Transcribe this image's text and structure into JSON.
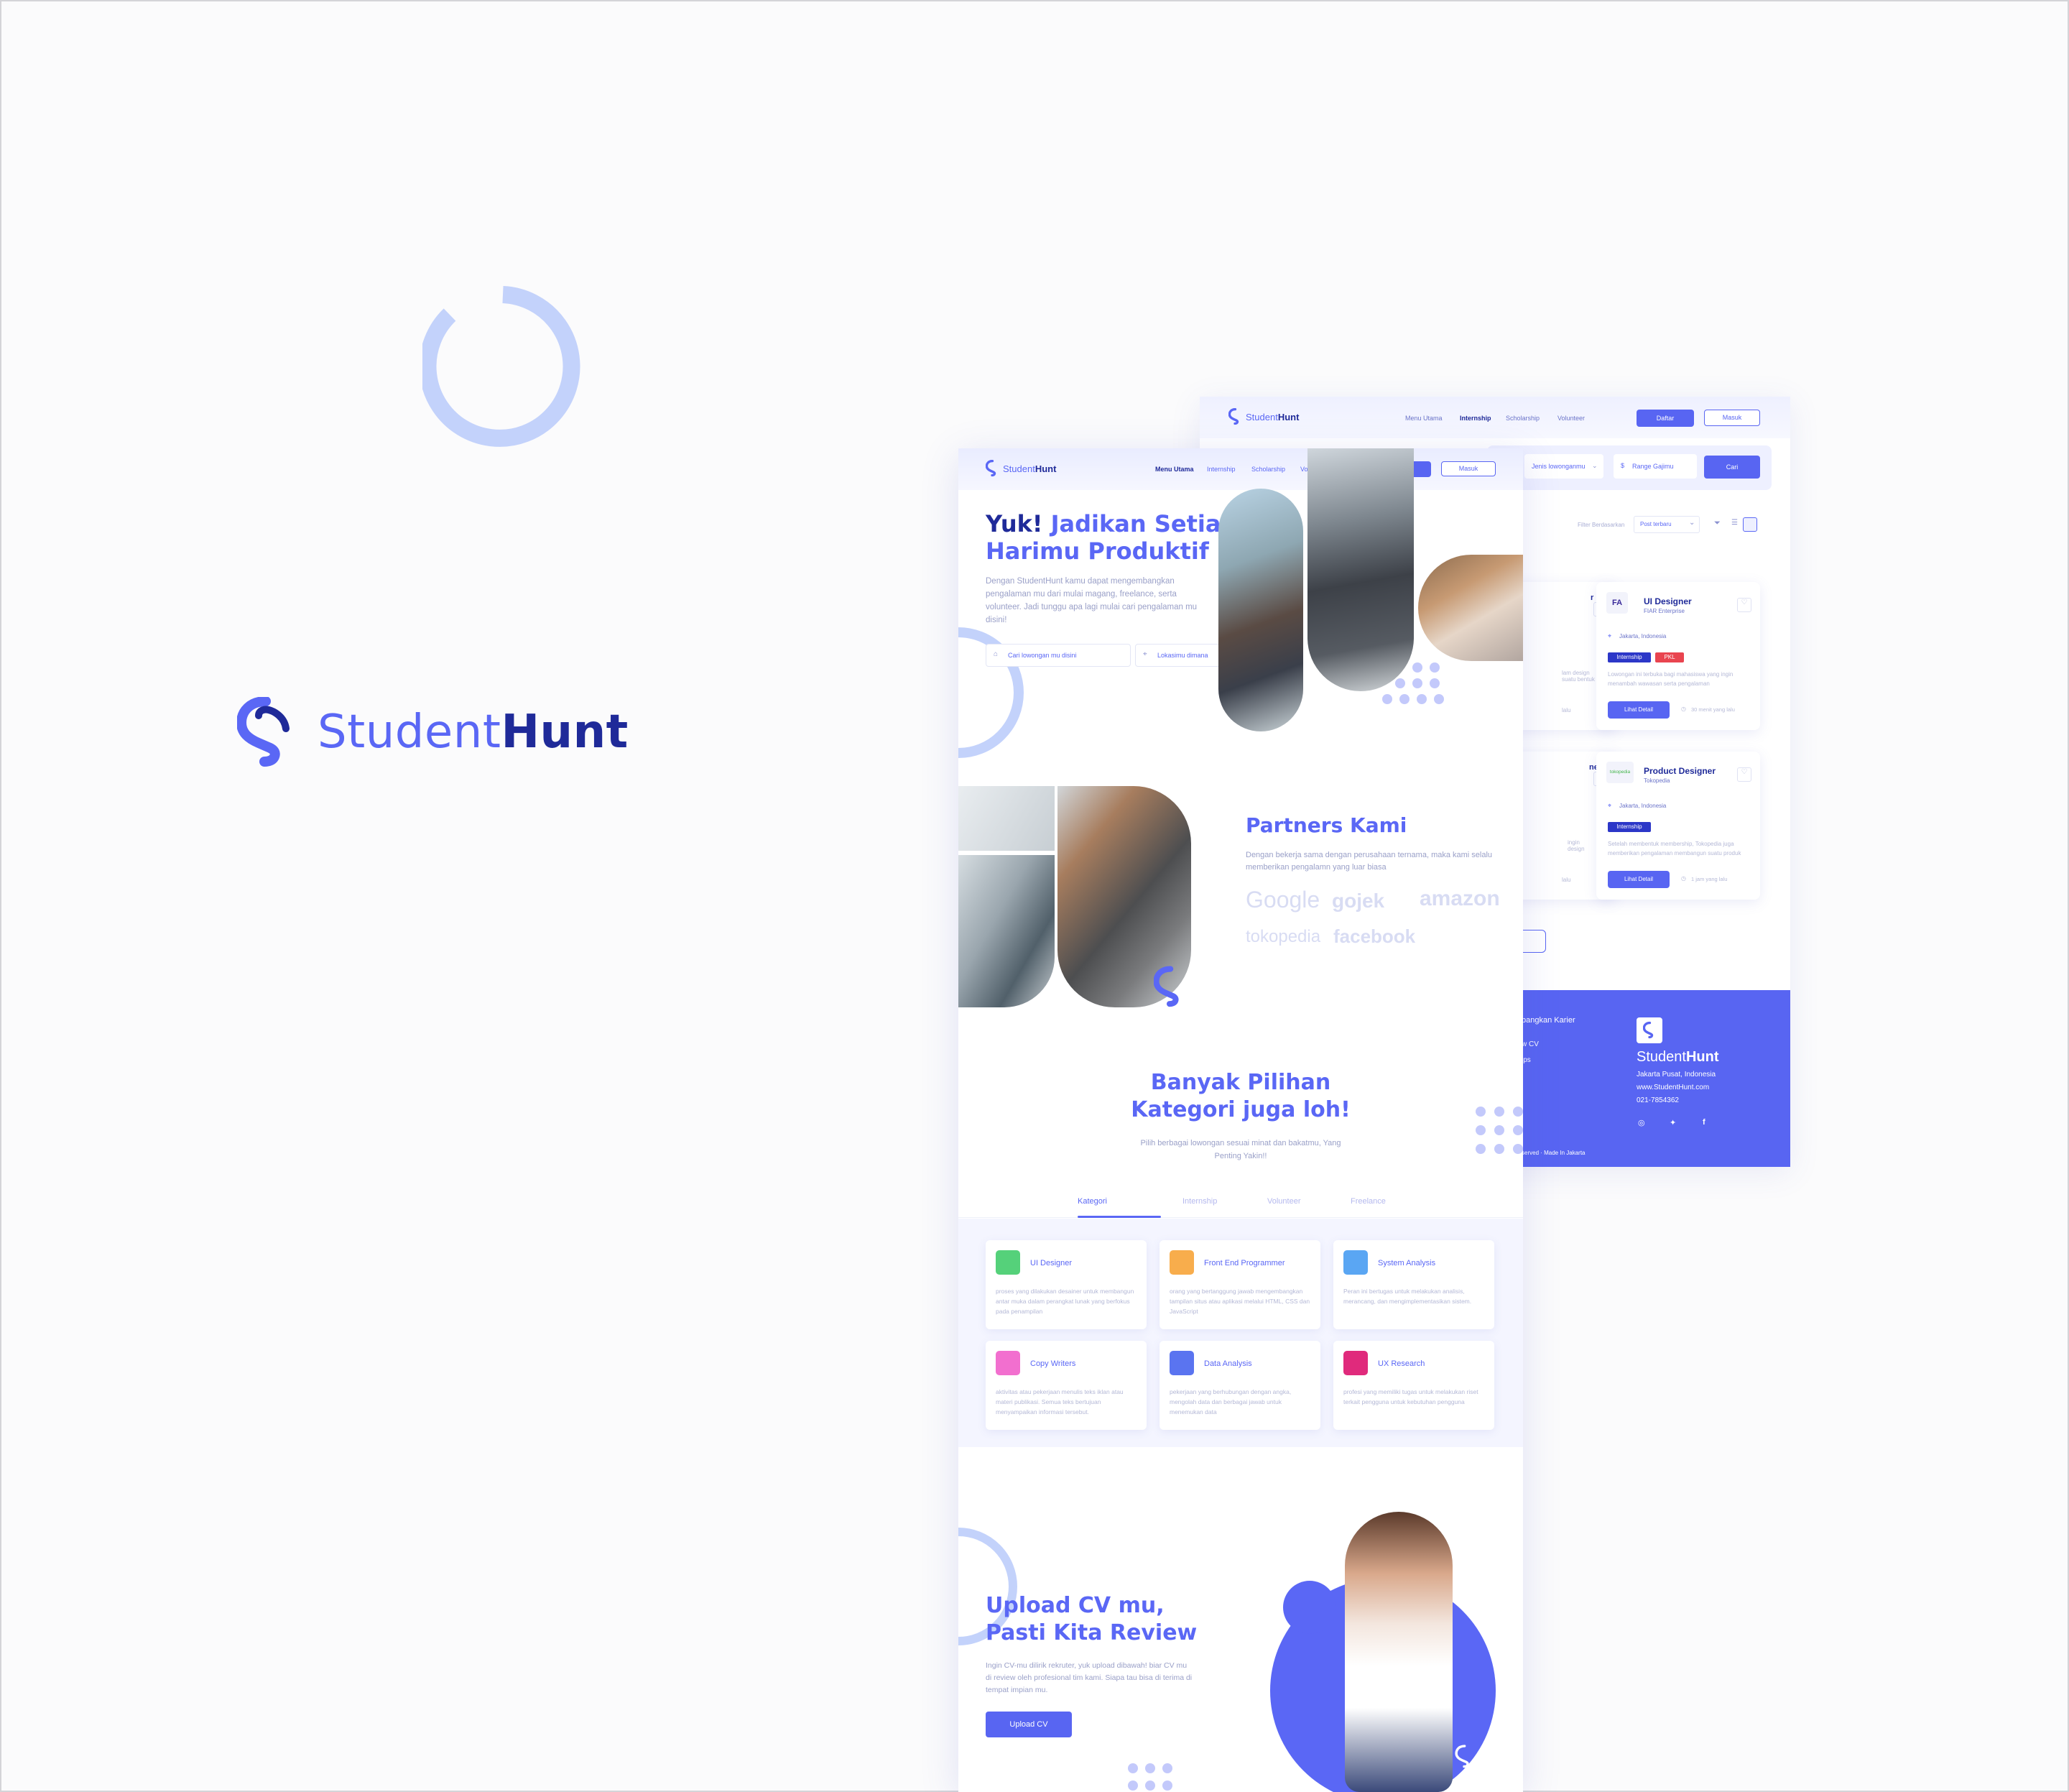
{
  "brand": {
    "part1": "Student",
    "part2": "Hunt"
  },
  "back": {
    "logo": {
      "part1": "Student",
      "part2": "Hunt"
    },
    "nav": [
      "Menu Utama",
      "Internship",
      "Scholarship",
      "Volunteer"
    ],
    "btn_daftar": "Daftar",
    "btn_masuk": "Masuk",
    "filter_jenis": "Jenis lowonganmu",
    "filter_gaji": "Range Gajimu",
    "btn_cari": "Cari",
    "sort_label": "Filter Berdasarkan",
    "sort_value": "Post terbaru",
    "cards": [
      {
        "title": "UI Designer",
        "company": "FIAR Enterprise",
        "location": "Jakarta, Indonesia",
        "tags": [
          "Internship",
          "PKL"
        ],
        "desc": "Lowongan ini terbuka bagi mahasiswa yang ingin menambah wawasan serta pengalaman",
        "button": "Lihat Detail",
        "time": "30 menit yang lalu",
        "logo": "FA"
      },
      {
        "title": "Product Designer",
        "company": "Tokopedia",
        "location": "Jakarta, Indonesia",
        "tags": [
          "Internship"
        ],
        "desc": "Setelah membentuk membership, Tokopedia juga memberikan pengalaman membangun suatu produk",
        "button": "Lihat Detail",
        "time": "1 jam yang lalu",
        "logo": "tokopedia"
      }
    ],
    "partial_cards": [
      {
        "title_frag": "r",
        "desc": "lam design\nsuatu bentuk",
        "time": "lalu"
      },
      {
        "title_frag": "ner",
        "desc": "ingin\ndesign",
        "time": "lalu"
      }
    ],
    "footer": {
      "col_title": "bangkan Karier",
      "col_items": [
        "w CV",
        "ips"
      ],
      "brand": {
        "part1": "Student",
        "part2": "Hunt"
      },
      "address": "Jakarta Pusat, Indonesia",
      "web": "www.StudentHunt.com",
      "phone": "021-7854362",
      "social": [
        "instagram-icon",
        "twitter-icon",
        "facebook-icon"
      ],
      "copy": "served · Made In Jakarta"
    }
  },
  "front": {
    "logo": {
      "part1": "Student",
      "part2": "Hunt"
    },
    "nav": [
      "Menu Utama",
      "Internship",
      "Scholarship",
      "Volunteer"
    ],
    "btn_daftar": "Daftar",
    "btn_masuk": "Masuk",
    "hero": {
      "title_l1a": "Yuk!",
      "title_l1b": " Jadikan Setiap",
      "title_l2": "Harimu  Produktif",
      "desc": "Dengan StudentHunt kamu dapat mengembangkan pengalaman mu dari mulai magang, freelance, serta volunteer. Jadi tunggu apa lagi mulai cari pengalaman mu disini!",
      "search_placeholder": "Cari lowongan mu disini",
      "location_placeholder": "Lokasimu dimana"
    },
    "partners": {
      "title": "Partners Kami",
      "desc": "Dengan bekerja sama dengan perusahaan ternama, maka kami selalu memberikan pengalamn yang luar biasa",
      "logos": [
        "Google",
        "gojek",
        "amazon",
        "tokopedia",
        "facebook"
      ]
    },
    "categories": {
      "title_l1": "Banyak Pilihan",
      "title_l2": "Kategori juga loh!",
      "desc": "Pilih berbagai lowongan sesuai minat dan bakatmu, Yang Penting Yakin!!",
      "tabs": [
        "Kategori",
        "Internship",
        "Volunteer",
        "Freelance"
      ],
      "items": [
        {
          "title": "UI Designer",
          "desc": "proses yang dilakukan desainer untuk membangun antar muka dalam perangkat lunak yang berfokus pada penampilan",
          "color": "#55d17a"
        },
        {
          "title": "Front End Programmer",
          "desc": "orang yang bertanggung jawab mengembangkan tampilan situs atau aplikasi melalui HTML, CSS dan JavaScript",
          "color": "#f8ad4c"
        },
        {
          "title": "System  Analysis",
          "desc": "Peran ini bertugas untuk melakukan analisis, merancang, dan mengimplementasikan sistem.",
          "color": "#5aa6f3"
        },
        {
          "title": "Copy Writers",
          "desc": "aktivitas atau pekerjaan menulis teks iklan atau materi publikasi. Semua teks bertujuan menyampaikan informasi tersebut.",
          "color": "#f26fcf"
        },
        {
          "title": "Data Analysis",
          "desc": "pekerjaan yang berhubungan dengan angka, mengolah data dan berbagai jawab untuk menemukan data",
          "color": "#5a74f0"
        },
        {
          "title": "UX Research",
          "desc": "profesi yang memiliki tugas untuk melakukan riset terkait pengguna untuk kebutuhan pengguna",
          "color": "#e02a7c"
        }
      ]
    },
    "upload": {
      "title_l1": "Upload CV mu,",
      "title_l2": "Pasti Kita Review",
      "desc": "Ingin CV-mu dilirik rekruter, yuk upload dibawah! biar CV mu di review oleh profesional tim kami. Siapa tau bisa di terima di tempat impian mu.",
      "button": "Upload CV"
    }
  }
}
